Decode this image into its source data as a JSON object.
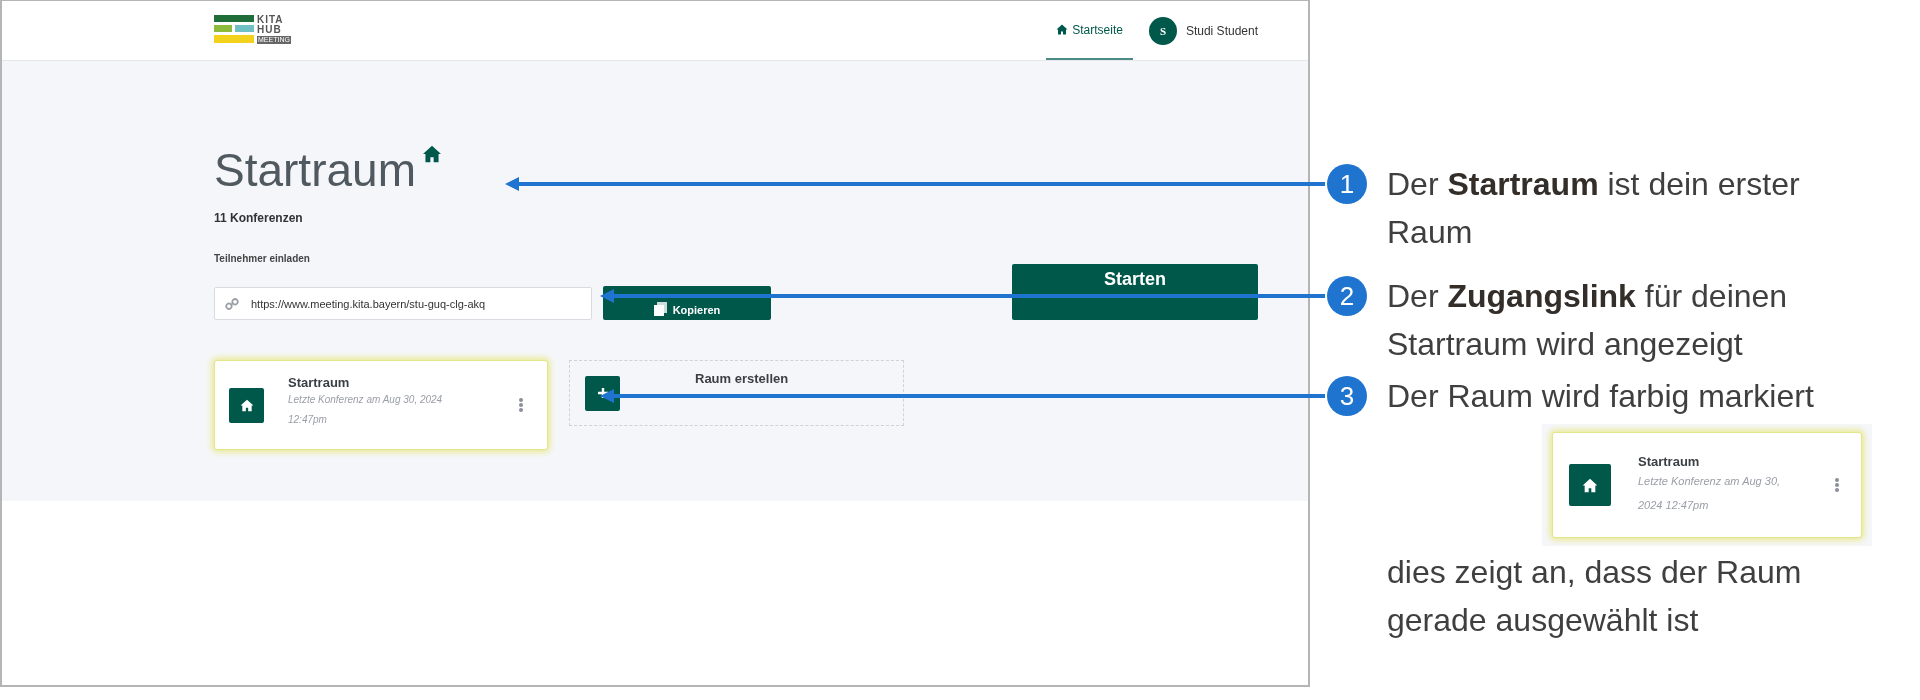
{
  "app": {
    "logo": {
      "lines": [
        "KITA",
        "HUB"
      ],
      "tag": "MEETING"
    },
    "nav": [
      {
        "label": "Startseite",
        "selected": true
      }
    ],
    "user": {
      "initial": "S",
      "name": "Studi Student"
    }
  },
  "room": {
    "title": "Startraum",
    "count": "11 Konferenzen",
    "invite_label": "Teilnehmer einladen",
    "link": "https://www.meeting.kita.bayern/stu-guq-clg-akq",
    "copy_button": "Kopieren",
    "start_button": "Starten"
  },
  "rooms": [
    {
      "kind": "room",
      "name": "Startraum",
      "last": "Letzte Konferenz am Aug 30, 2024 12:47pm",
      "selected": true
    },
    {
      "kind": "create",
      "label": "Raum erstellen"
    }
  ],
  "callouts": [
    {
      "number": "1",
      "text": "Der **Startraum** ist dein erster Raum"
    },
    {
      "number": "2",
      "text": "Der **Zugangslink** für deinen Startraum wird angezeigt"
    },
    {
      "number": "3",
      "text": "Der Raum wird farbig markiert"
    }
  ],
  "inset_card": {
    "name": "Startraum",
    "last": "Letzte Konferenz am Aug 30, 2024 12:47pm",
    "selected": true
  },
  "note": "dies zeigt an, dass der Raum gerade ausgewählt ist"
}
